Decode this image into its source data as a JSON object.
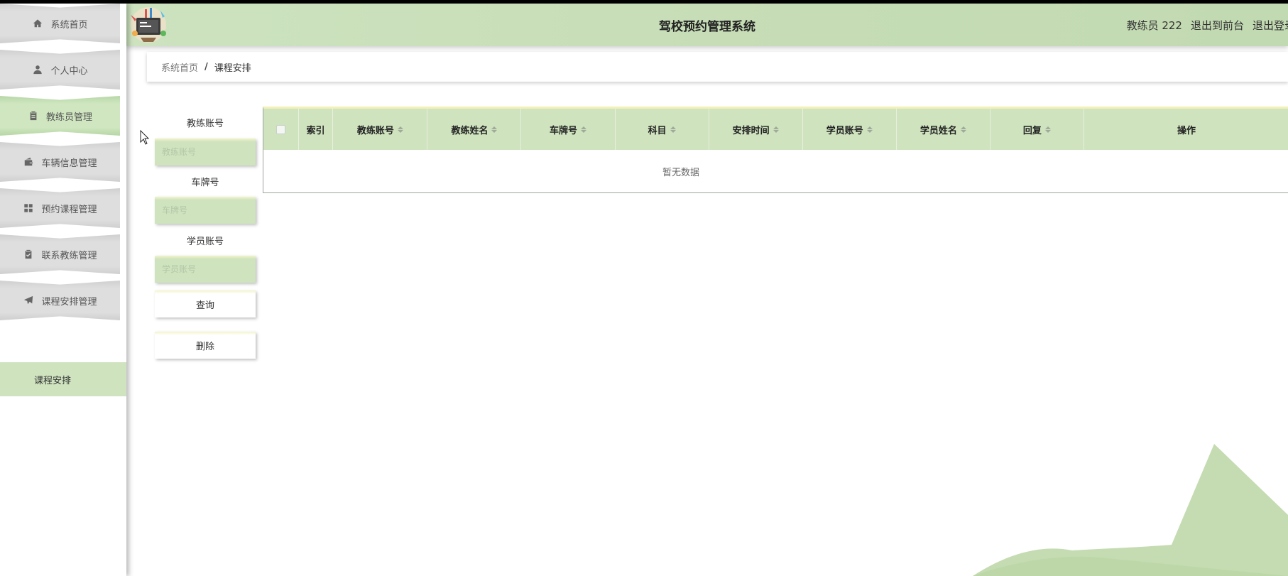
{
  "app": {
    "title": "驾校预约管理系统"
  },
  "header": {
    "user_label": "教练员 222",
    "front_link": "退出到前台",
    "logout_link": "退出登录"
  },
  "sidebar": {
    "items": [
      {
        "label": "系统首页",
        "icon": "home-icon"
      },
      {
        "label": "个人中心",
        "icon": "user-icon"
      },
      {
        "label": "教练员管理",
        "icon": "clipboard-icon"
      },
      {
        "label": "车辆信息管理",
        "icon": "wallet-icon"
      },
      {
        "label": "预约课程管理",
        "icon": "grid-icon"
      },
      {
        "label": "联系教练管理",
        "icon": "clipboard-check-icon"
      },
      {
        "label": "课程安排管理",
        "icon": "paper-plane-icon"
      }
    ],
    "active_sub": "课程安排"
  },
  "breadcrumb": {
    "home": "系统首页",
    "separator": "/",
    "current": "课程安排"
  },
  "search": {
    "fields": [
      {
        "label": "教练账号",
        "placeholder": "教练账号"
      },
      {
        "label": "车牌号",
        "placeholder": "车牌号"
      },
      {
        "label": "学员账号",
        "placeholder": "学员账号"
      }
    ],
    "query_label": "查询",
    "delete_label": "删除"
  },
  "table": {
    "columns": [
      {
        "label": "索引",
        "sortable": false
      },
      {
        "label": "教练账号",
        "sortable": true
      },
      {
        "label": "教练姓名",
        "sortable": true
      },
      {
        "label": "车牌号",
        "sortable": true
      },
      {
        "label": "科目",
        "sortable": true
      },
      {
        "label": "安排时间",
        "sortable": true
      },
      {
        "label": "学员账号",
        "sortable": true
      },
      {
        "label": "学员姓名",
        "sortable": true
      },
      {
        "label": "回复",
        "sortable": true
      },
      {
        "label": "操作",
        "sortable": false
      }
    ],
    "empty_text": "暂无数据"
  },
  "colors": {
    "accent": "#cfe3bf",
    "header_bg": "#c5dcb5",
    "menu_bg": "#dedede",
    "highlight": "#f3f0b8"
  }
}
